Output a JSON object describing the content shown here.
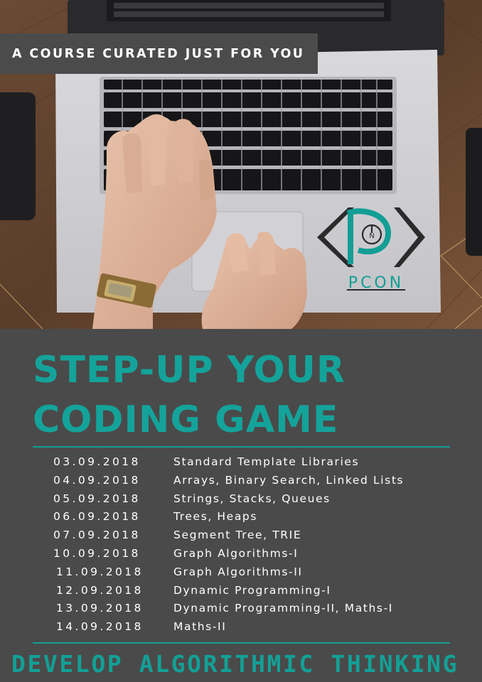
{
  "banner": {
    "text": "A COURSE CURATED JUST FOR YOU"
  },
  "logo": {
    "text": "PCON"
  },
  "headline": {
    "line1": "STEP-UP YOUR",
    "line2": "CODING GAME"
  },
  "schedule": [
    {
      "date": "03.09.2018",
      "topic": "Standard Template Libraries"
    },
    {
      "date": "04.09.2018",
      "topic": "Arrays, Binary Search, Linked Lists"
    },
    {
      "date": "05.09.2018",
      "topic": "Strings, Stacks, Queues"
    },
    {
      "date": "06.09.2018",
      "topic": "Trees, Heaps"
    },
    {
      "date": "07.09.2018",
      "topic": "Segment Tree, TRIE"
    },
    {
      "date": "10.09.2018",
      "topic": "Graph Algorithms-I"
    },
    {
      "date": "11.09.2018",
      "topic": "Graph Algorithms-II"
    },
    {
      "date": "12.09.2018",
      "topic": "Dynamic Programming-I"
    },
    {
      "date": "13.09.2018",
      "topic": "Dynamic Programming-II, Maths-I"
    },
    {
      "date": "14.09.2018",
      "topic": "Maths-II"
    }
  ],
  "footer": {
    "text": "DEVELOP ALGORITHMIC THINKING"
  },
  "colors": {
    "accent": "#14a39a",
    "background": "#4a4a4a",
    "text": "#ffffff"
  }
}
